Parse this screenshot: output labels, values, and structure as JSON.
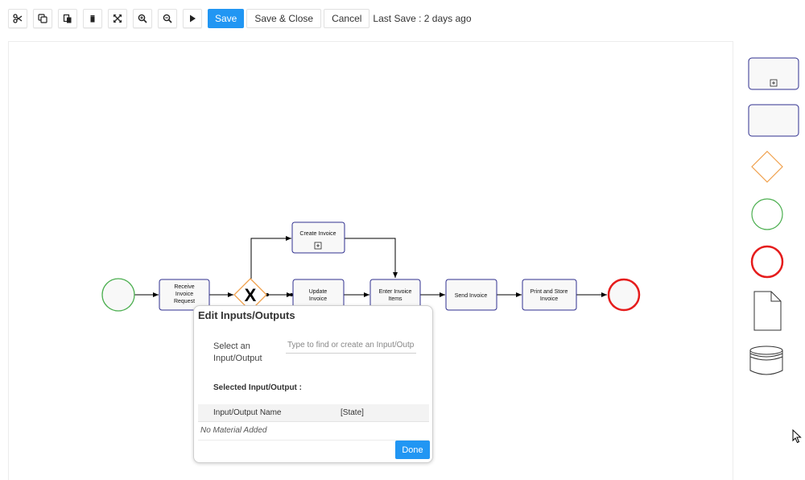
{
  "toolbar": {
    "icons": [
      "scissors-icon",
      "copy-icon",
      "paste-icon",
      "delete-icon",
      "fit-screen-icon",
      "zoom-in-icon",
      "zoom-out-icon",
      "play-icon"
    ],
    "save_label": "Save",
    "save_close_label": "Save & Close",
    "cancel_label": "Cancel",
    "last_save": "Last Save : 2 days ago"
  },
  "diagram": {
    "tasks": {
      "receive": [
        "Receive",
        "Invoice",
        "Request"
      ],
      "create": "Create Invoice",
      "update": [
        "Update",
        "Invoice"
      ],
      "enter": [
        "Enter Invoice",
        "Items"
      ],
      "send": "Send Invoice",
      "print": [
        "Print and Store",
        "Invoice"
      ]
    },
    "gateway_symbol": "X",
    "expand_symbol": "+"
  },
  "palette": {
    "items": [
      "subprocess-shape",
      "task-shape",
      "gateway-shape",
      "start-event-shape",
      "end-event-shape",
      "document-shape",
      "datastore-shape"
    ]
  },
  "dialog": {
    "title": "Edit Inputs/Outputs",
    "select_label": "Select an Input/Output",
    "input_placeholder": "Type to find or create an Input/Output",
    "selected_label": "Selected Input/Output :",
    "columns": [
      "Input/Output Name",
      "[State]"
    ],
    "empty_text": "No Material Added",
    "done_label": "Done"
  },
  "colors": {
    "accent": "#2196f3",
    "task_border": "#2f2f8f",
    "start_event": "#4caf50",
    "end_event": "#e51c1c",
    "gateway": "#f0a04b"
  }
}
